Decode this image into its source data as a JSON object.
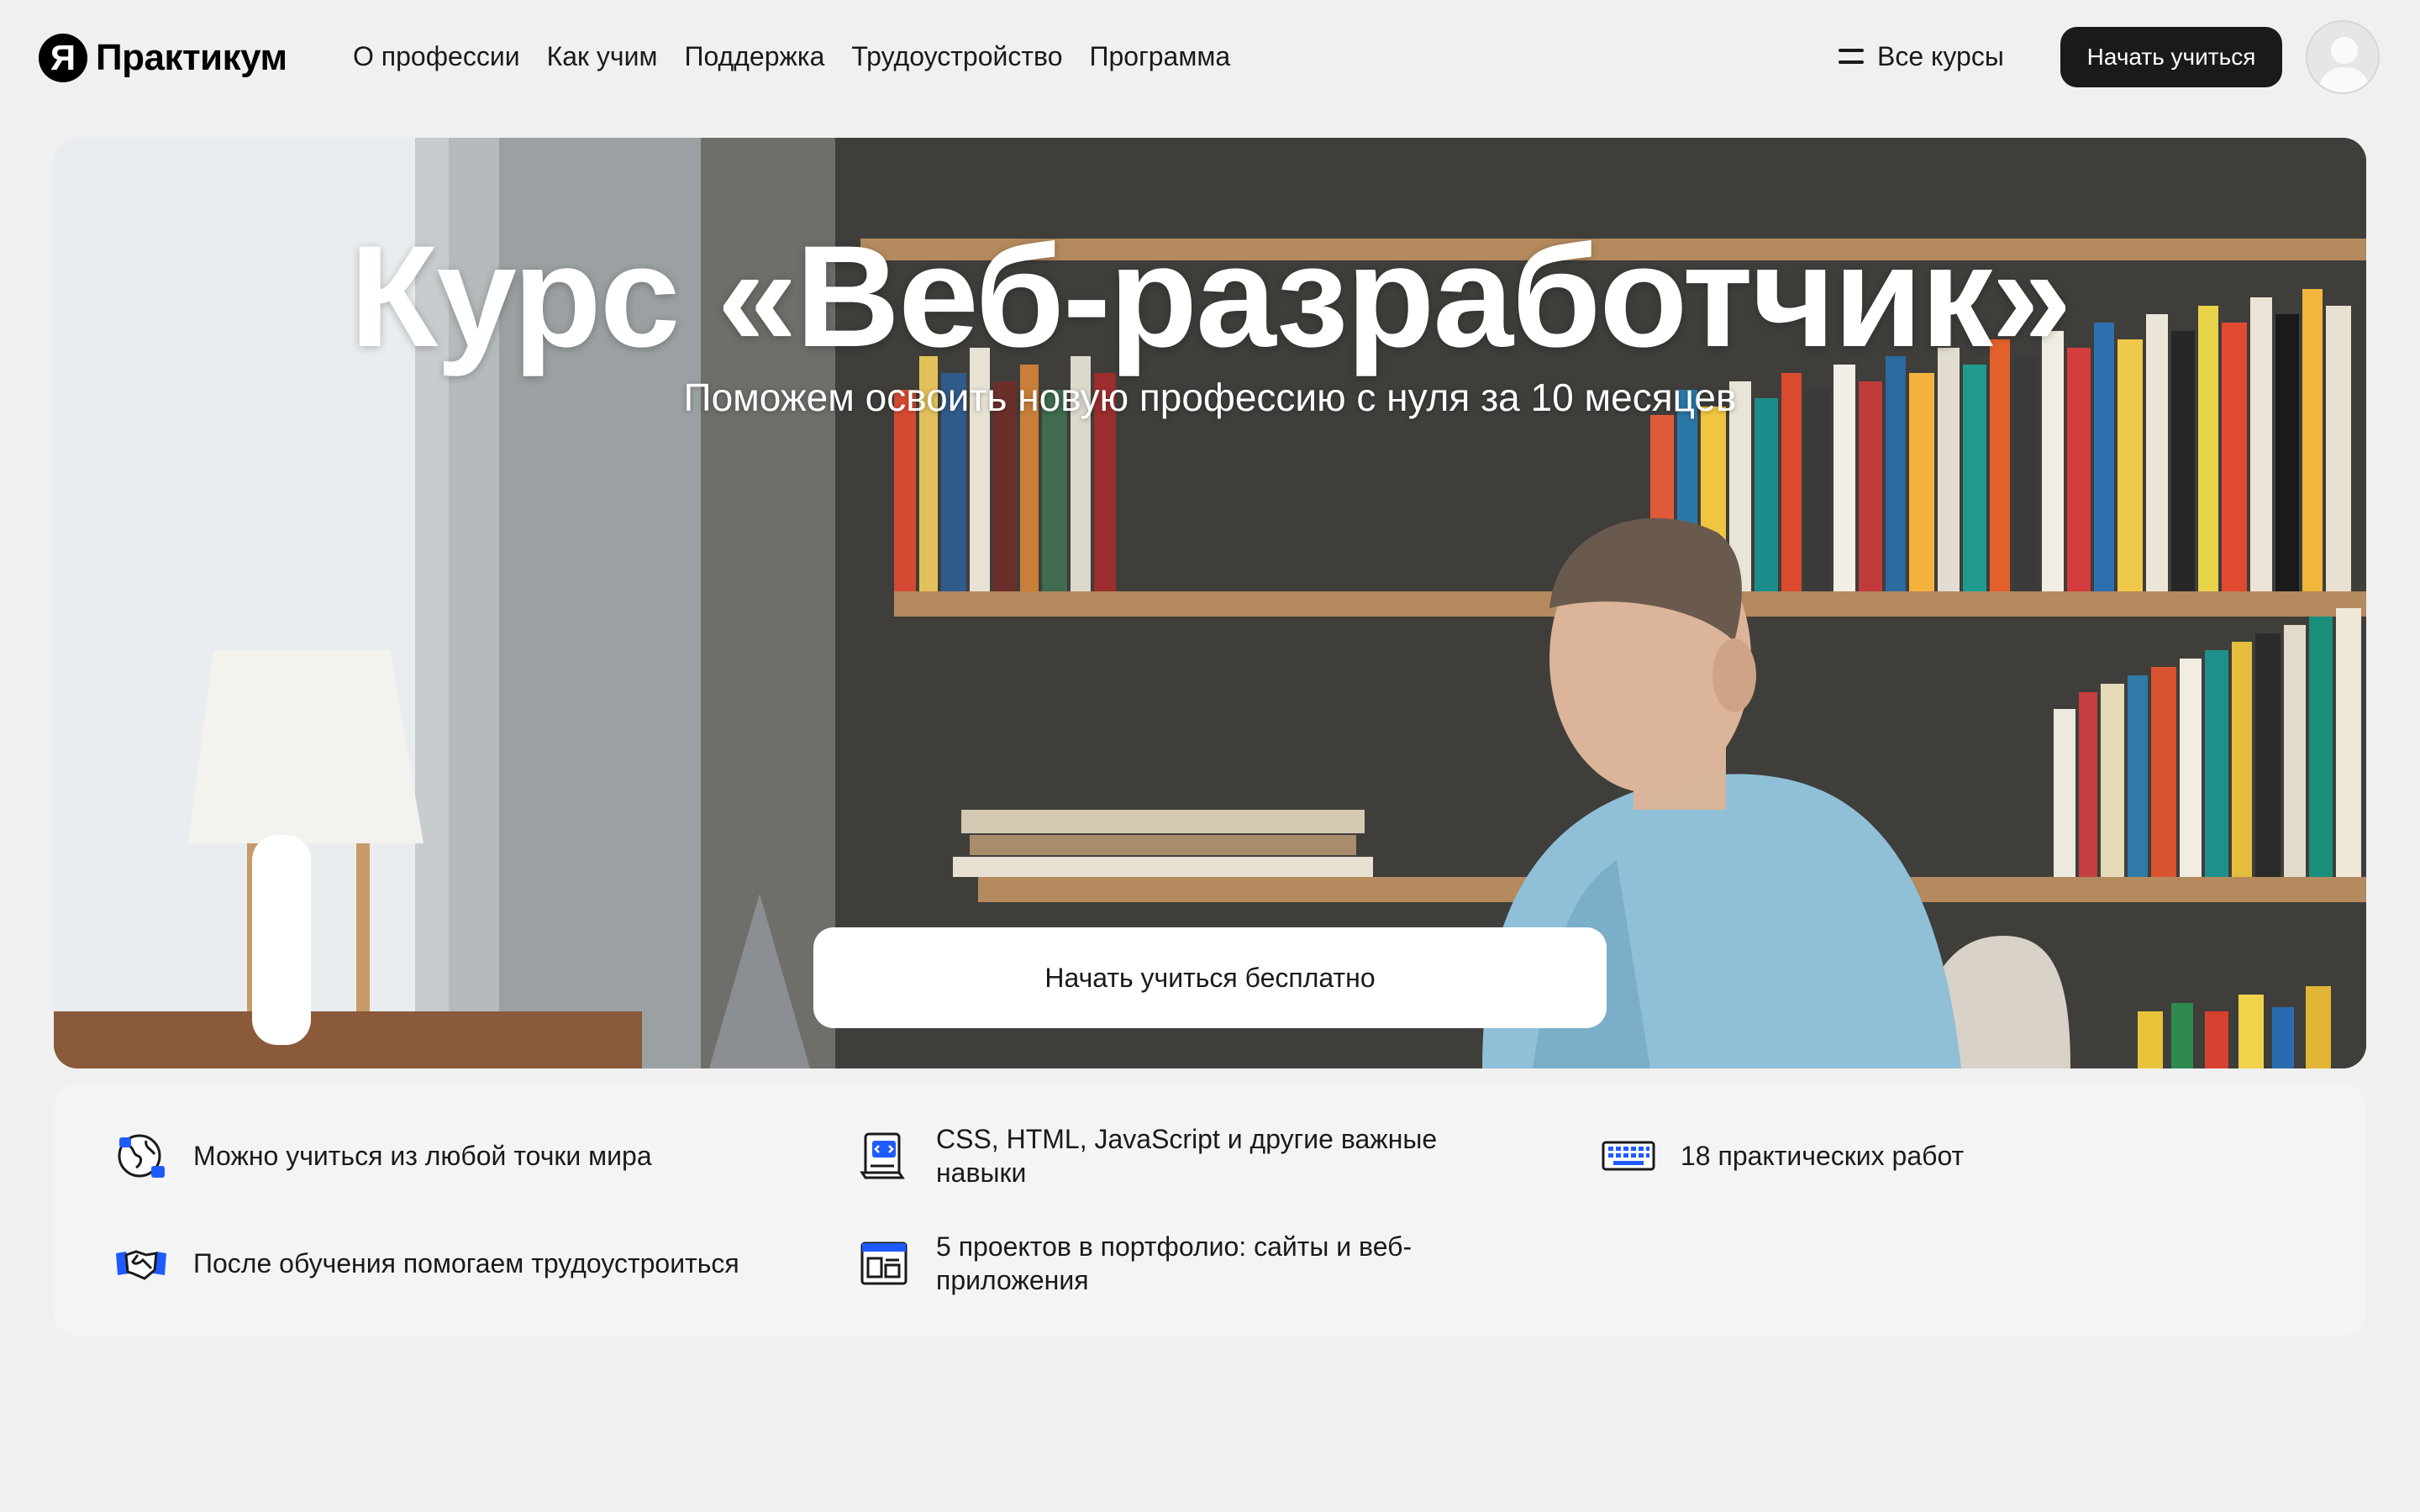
{
  "header": {
    "logo_mark": "Я",
    "logo_text": "Практикум",
    "nav": [
      "О профессии",
      "Как учим",
      "Поддержка",
      "Трудоустройство",
      "Программа"
    ],
    "all_courses": "Все курсы",
    "start_button": "Начать учиться"
  },
  "hero": {
    "title": "Курс «Веб-разработчик»",
    "subtitle": "Поможем освоить новую профессию с нуля за 10 месяцев",
    "cta": "Начать учиться бесплатно"
  },
  "features": [
    {
      "icon": "globe-icon",
      "text": "Можно учиться из любой точки мира"
    },
    {
      "icon": "code-document-icon",
      "text": "CSS, HTML, JavaScript и другие важные навыки"
    },
    {
      "icon": "keyboard-icon",
      "text": "18 практических работ"
    },
    {
      "icon": "handshake-icon",
      "text": "После обучения помогаем трудоустроиться"
    },
    {
      "icon": "browser-window-icon",
      "text": "5 проектов в портфолио: сайты и веб-приложения"
    }
  ],
  "colors": {
    "accent_blue": "#1e5bff",
    "dark_button": "#1a1a1a",
    "page_bg": "#f0f0f0"
  }
}
